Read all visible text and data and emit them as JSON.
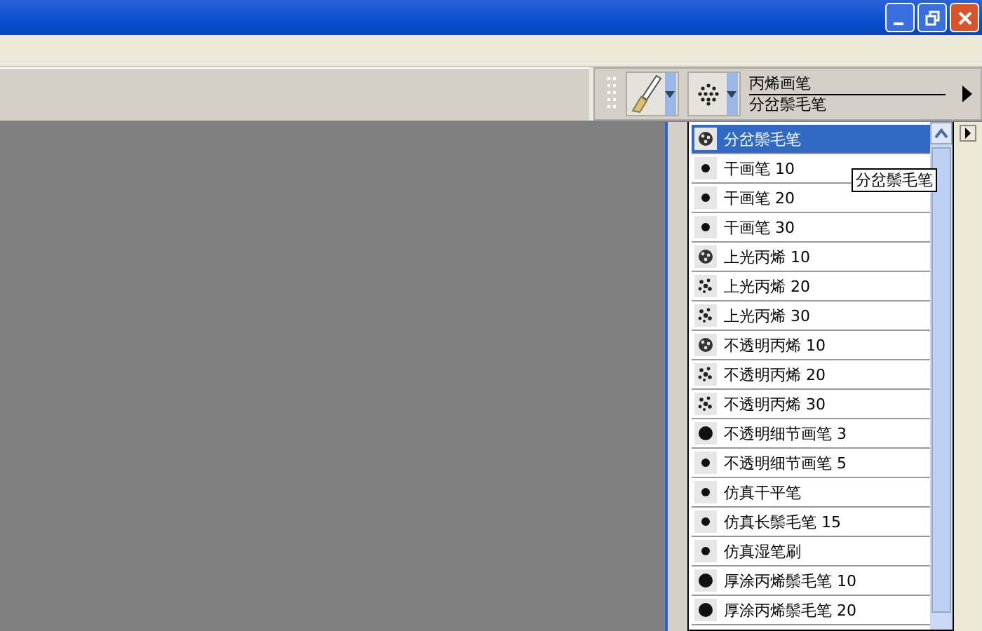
{
  "toolbar": {
    "brush_category": "丙烯画笔",
    "brush_variant": "分岔鬃毛笔"
  },
  "brush_list": [
    {
      "label": "分岔鬃毛笔",
      "kind": "bristle",
      "selected": true
    },
    {
      "label": "干画笔 10",
      "kind": "dot",
      "selected": false
    },
    {
      "label": "干画笔 20",
      "kind": "dot",
      "selected": false
    },
    {
      "label": "干画笔 30",
      "kind": "dot",
      "selected": false
    },
    {
      "label": "上光丙烯 10",
      "kind": "bristle",
      "selected": false
    },
    {
      "label": "上光丙烯 20",
      "kind": "speckle",
      "selected": false
    },
    {
      "label": "上光丙烯 30",
      "kind": "speckle",
      "selected": false
    },
    {
      "label": "不透明丙烯 10",
      "kind": "bristle",
      "selected": false
    },
    {
      "label": "不透明丙烯 20",
      "kind": "speckle",
      "selected": false
    },
    {
      "label": "不透明丙烯 30",
      "kind": "speckle",
      "selected": false
    },
    {
      "label": "不透明细节画笔 3",
      "kind": "large-dot",
      "selected": false
    },
    {
      "label": "不透明细节画笔 5",
      "kind": "dot",
      "selected": false
    },
    {
      "label": "仿真干平笔",
      "kind": "dot",
      "selected": false
    },
    {
      "label": "仿真长鬃毛笔 15",
      "kind": "dot",
      "selected": false
    },
    {
      "label": "仿真湿笔刷",
      "kind": "dot",
      "selected": false
    },
    {
      "label": "厚涂丙烯鬃毛笔 10",
      "kind": "large-dot",
      "selected": false
    },
    {
      "label": "厚涂丙烯鬃毛笔 20",
      "kind": "large-dot",
      "selected": false
    }
  ],
  "tooltip": "分岔鬃毛笔"
}
